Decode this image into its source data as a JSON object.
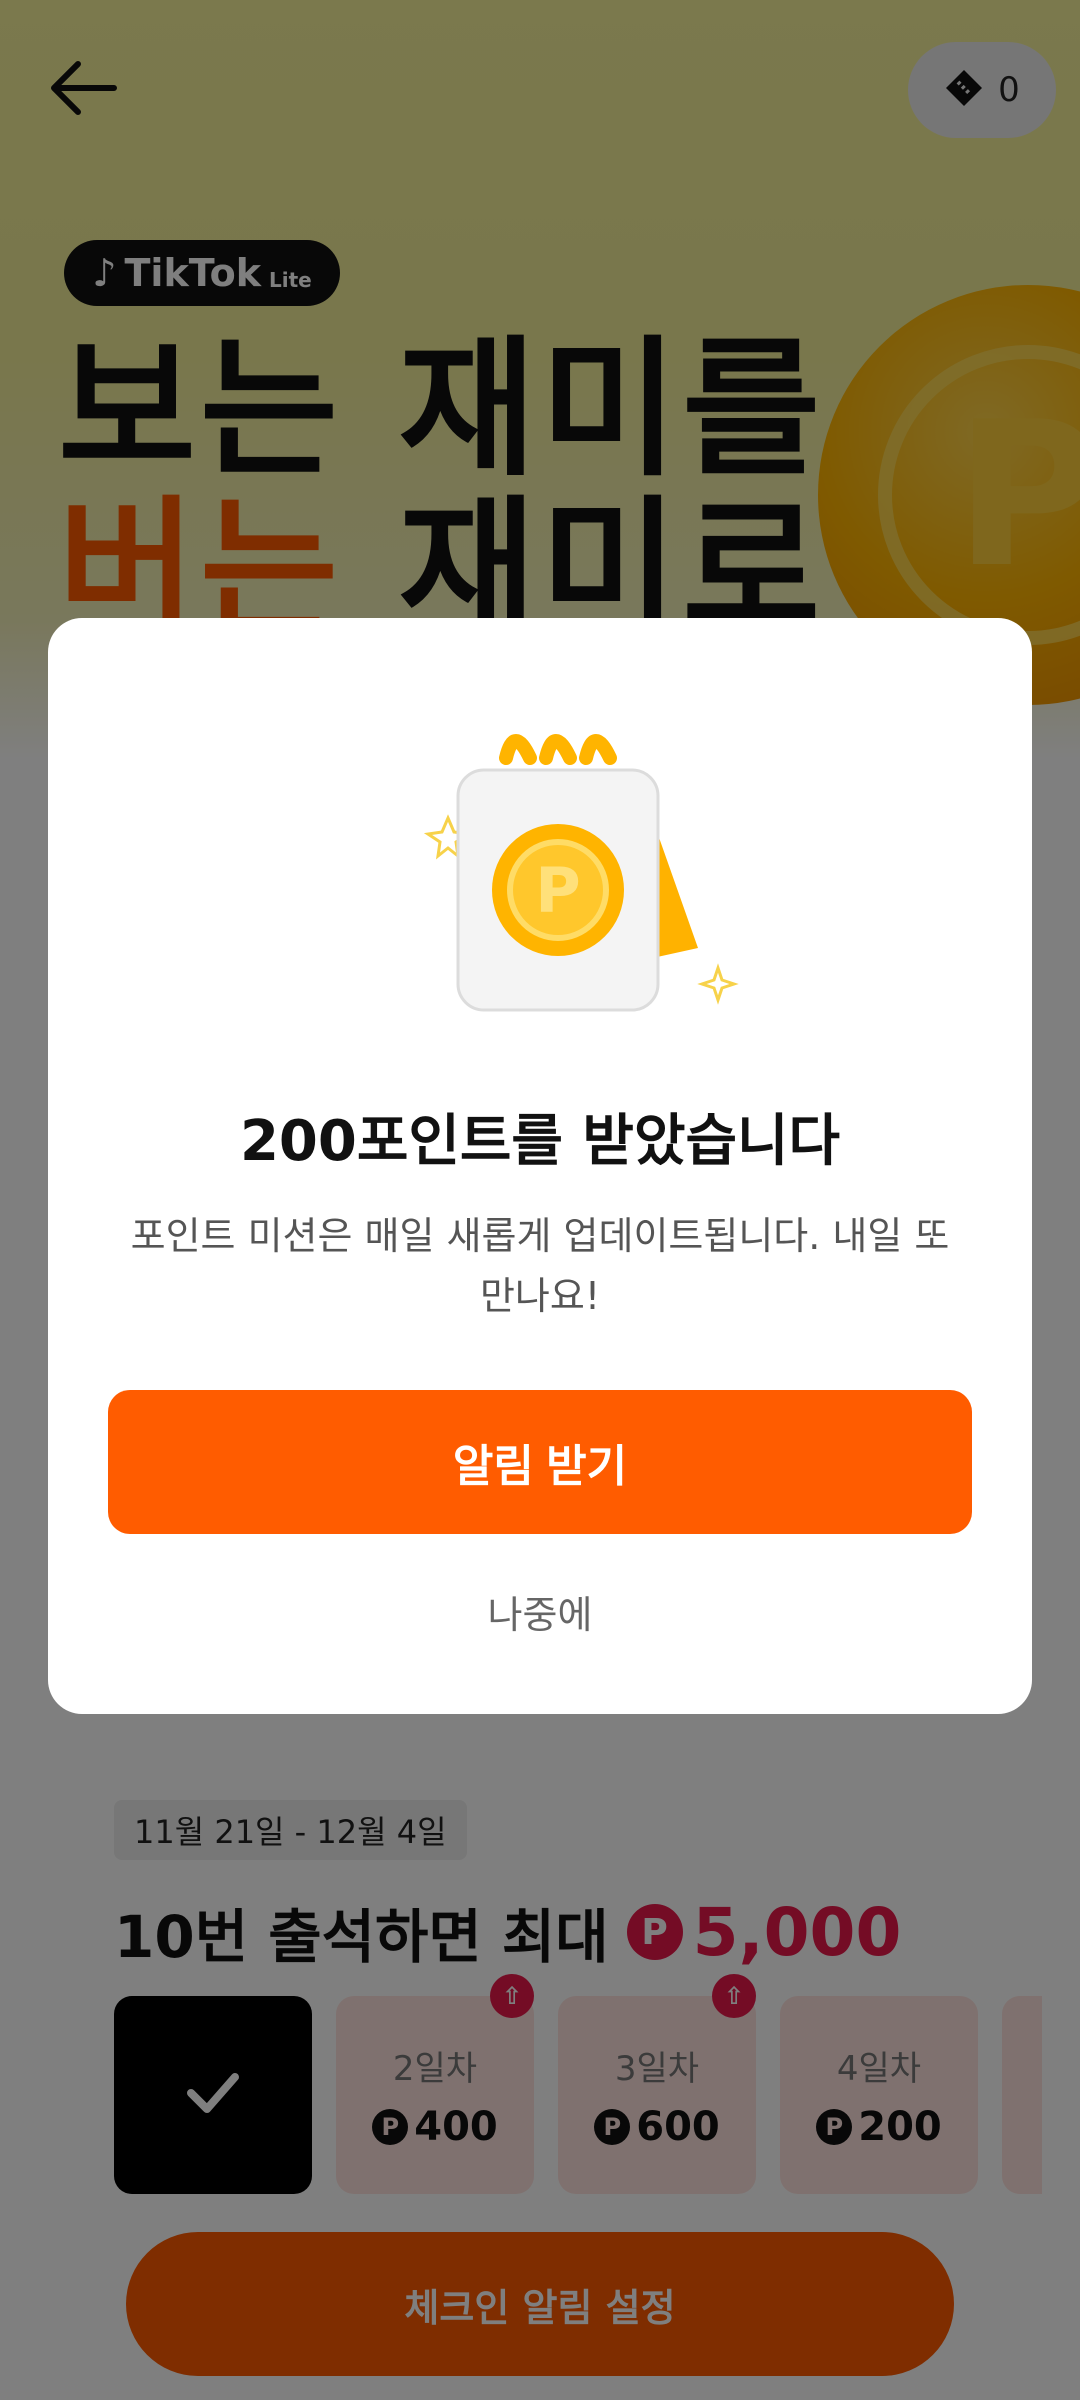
{
  "header": {
    "ticket_count": "0"
  },
  "banner": {
    "brand": "TikTok",
    "brand_suffix": "Lite",
    "hero_line1": "보는 재미를",
    "hero_line2_accent": "버는",
    "hero_line2_rest": " 재미로",
    "coin_letter": "P"
  },
  "modal": {
    "title": "200포인트를 받았습니다",
    "description": "포인트 미션은 매일 새롭게 업데이트됩니다. 내일 또 만나요!",
    "primary_button": "알림 받기",
    "secondary_button": "나중에",
    "coin_letter": "P"
  },
  "attendance": {
    "date_range": "11월 21일 - 12월 4일",
    "title": "10번 출석하면 최대",
    "max_reward": "5,000",
    "currency_symbol": "P",
    "days": [
      {
        "label": "",
        "points": "",
        "state": "done"
      },
      {
        "label": "2일차",
        "points": "400",
        "boost": true
      },
      {
        "label": "3일차",
        "points": "600",
        "boost": true
      },
      {
        "label": "4일차",
        "points": "200",
        "boost": false
      }
    ],
    "checkin_button": "체크인 알림 설정"
  },
  "colors": {
    "accent_orange": "#ff5c00",
    "reward_red": "#e8194a"
  }
}
